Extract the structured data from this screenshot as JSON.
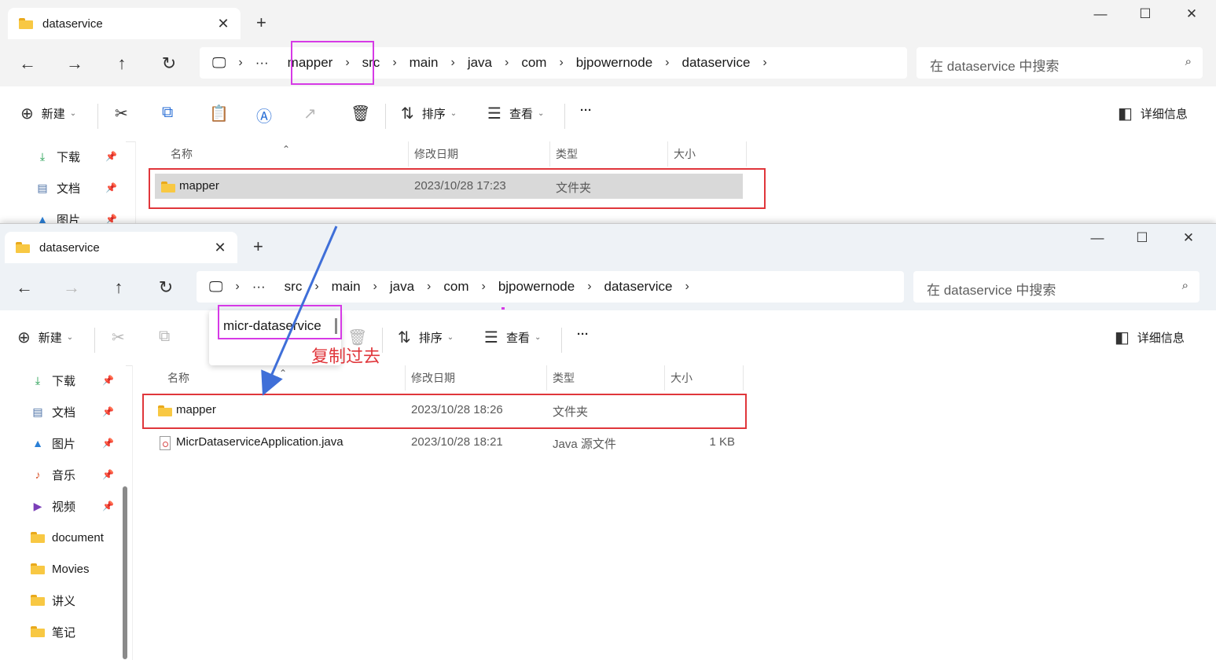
{
  "colors": {
    "accent_red": "#e0363b",
    "accent_magenta": "#d63ae6",
    "arrow_blue": "#3f6fd8",
    "folder_yellow": "#f8c843"
  },
  "top_window": {
    "tab_title": "dataservice",
    "new_tab": "+",
    "window_controls": {
      "minimize": "—",
      "maximize": "☐",
      "close": "✕"
    },
    "nav": {
      "back": "←",
      "forward": "→",
      "up": "↑",
      "refresh": "↻"
    },
    "address_more": "···",
    "breadcrumbs": [
      "mapper",
      "src",
      "main",
      "java",
      "com",
      "bjpowernode",
      "dataservice"
    ],
    "search_placeholder": "在 dataservice 中搜索",
    "commands": {
      "new": "新建",
      "sort": "排序",
      "view": "查看",
      "more": "···",
      "details": "详细信息"
    },
    "sidebar": [
      {
        "label": "下载",
        "icon": "download-icon"
      },
      {
        "label": "文档",
        "icon": "document-icon"
      },
      {
        "label": "图片",
        "icon": "pictures-icon"
      }
    ],
    "columns": {
      "name": "名称",
      "modified": "修改日期",
      "type": "类型",
      "size": "大小"
    },
    "rows": [
      {
        "name": "mapper",
        "modified": "2023/10/28 17:23",
        "type": "文件夹",
        "size": ""
      }
    ]
  },
  "bottom_window": {
    "tab_title": "dataservice",
    "new_tab": "+",
    "window_controls": {
      "minimize": "—",
      "maximize": "☐",
      "close": "✕"
    },
    "nav": {
      "back": "←",
      "forward": "→",
      "up": "↑",
      "refresh": "↻"
    },
    "address_more": "···",
    "breadcrumbs": [
      "src",
      "main",
      "java",
      "com",
      "bjpowernode",
      "dataservice"
    ],
    "breadcrumb_dropdown_item": "micr-dataservice",
    "search_placeholder": "在 dataservice 中搜索",
    "commands": {
      "new": "新建",
      "sort": "排序",
      "view": "查看",
      "more": "···",
      "details": "详细信息"
    },
    "sidebar": [
      {
        "label": "下载",
        "icon": "download-icon",
        "pinned": true
      },
      {
        "label": "文档",
        "icon": "document-icon",
        "pinned": true
      },
      {
        "label": "图片",
        "icon": "pictures-icon",
        "pinned": true
      },
      {
        "label": "音乐",
        "icon": "music-icon",
        "pinned": true
      },
      {
        "label": "视频",
        "icon": "video-icon",
        "pinned": true
      },
      {
        "label": "document",
        "icon": "folder-icon",
        "pinned": false
      },
      {
        "label": "Movies",
        "icon": "folder-icon",
        "pinned": false
      },
      {
        "label": "讲义",
        "icon": "folder-icon",
        "pinned": false
      },
      {
        "label": "笔记",
        "icon": "folder-icon",
        "pinned": false
      }
    ],
    "columns": {
      "name": "名称",
      "modified": "修改日期",
      "type": "类型",
      "size": "大小"
    },
    "rows": [
      {
        "name": "mapper",
        "modified": "2023/10/28 18:26",
        "type": "文件夹",
        "size": "",
        "icon": "folder-icon"
      },
      {
        "name": "MicrDataserviceApplication.java",
        "modified": "2023/10/28 18:21",
        "type": "Java 源文件",
        "size": "1 KB",
        "icon": "java-file-icon"
      }
    ]
  },
  "annotation": {
    "text": "复制过去"
  }
}
